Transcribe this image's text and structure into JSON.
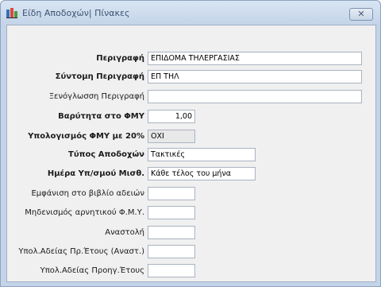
{
  "window": {
    "title": "Είδη Αποδοχών| Πίνακες",
    "close_label": "✕"
  },
  "form": {
    "fields": [
      {
        "label": "Περιγραφή",
        "value": "ΕΠΙΔΟΜΑ ΤΗΛΕΡΓΑΣΙΑΣ"
      },
      {
        "label": "Σύντομη Περιγραφή",
        "value": "ΕΠ ΤΗΛ"
      },
      {
        "label": "Ξενόγλωσση Περιγραφή",
        "value": ""
      },
      {
        "label": "Βαρύτητα στο ΦΜΥ",
        "value": "1,00"
      },
      {
        "label": "Υπολογισμός ΦΜΥ με 20%",
        "value": "ΟΧΙ"
      },
      {
        "label": "Τύπος Αποδοχών",
        "value": "Τακτικές"
      },
      {
        "label": "Ημέρα Υπ/σμού Μισθ.",
        "value": "Κάθε τέλος του μήνα"
      },
      {
        "label": "Εμφάνιση στο βιβλίο αδειών",
        "value": ""
      },
      {
        "label": "Μηδενισμός αρνητικού Φ.Μ.Υ.",
        "value": ""
      },
      {
        "label": "Αναστολή",
        "value": ""
      },
      {
        "label": "Υπολ.Αδείας Πρ.Έτους (Αναστ.)",
        "value": ""
      },
      {
        "label": "Υπολ.Αδείας Προηγ.Έτους",
        "value": ""
      }
    ]
  }
}
